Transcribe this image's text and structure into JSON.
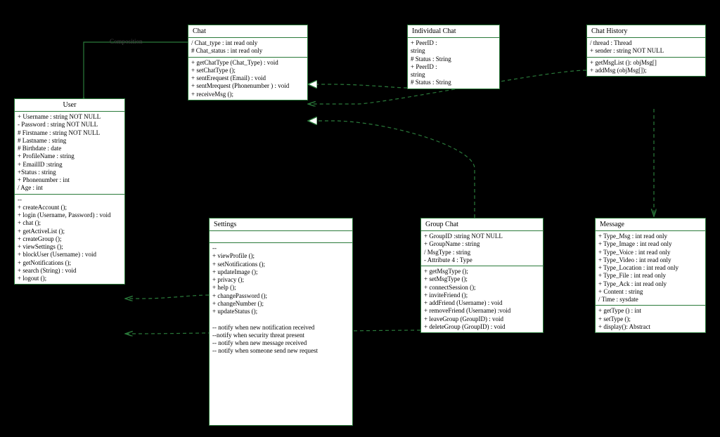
{
  "diagram_type": "UML Class Diagram",
  "classes": {
    "user": {
      "name": "User",
      "attrs": [
        "+ Username   : string  NOT NULL",
        "- Password   : string  NOT NULL",
        "# Firstname    : string  NOT NULL",
        "# Lastname         : string",
        "# Birthdate          : date",
        "+ ProfileName   : string",
        "+ EmailID       :string",
        "+Status            : string",
        "+ Phonenumber    : int",
        "/  Age               : int"
      ],
      "ops": [
        "--",
        "+ createAccount  ();",
        "+ login (Username, Password)  : void",
        "+ chat ();",
        "+ getActiveList  ();",
        "+ createGroup  ();",
        "+ viewSettings  ();",
        "+ blockUser  (Username)  : void",
        "+ getNotifications  ();",
        "+ search  (String) : void",
        "+ logout ();"
      ]
    },
    "chat": {
      "name": "Chat",
      "attrs": [
        "/ Chat_type   : int read only",
        "# Chat_status  : int read only"
      ],
      "ops": [
        "+ getChatType   (Chat_Type) : void",
        "+ setChatType   ();",
        "+ sentErequest   (Email)  : void",
        "+ sentMrequest   (Phonenumber  ) : void",
        "+ receiveMsg  ();"
      ]
    },
    "individual": {
      "name": "Individual Chat",
      "attrs": [
        "+ PeerID  :",
        "string",
        "# Status  : String",
        "+ PeerID   :",
        "string",
        "# Status  : String"
      ],
      "ops": []
    },
    "history": {
      "name": "Chat History",
      "attrs": [
        "/ thread  : Thread",
        "+ sender  : string  NOT NULL"
      ],
      "ops": [
        "+ getMsgList  (): objMsg[]",
        "+ addMsg  (objMsg[]);"
      ]
    },
    "settings": {
      "name": "Settings",
      "ops": [
        "--",
        "+ viewProfile ();",
        "+ setNotifications  ();",
        "+ updateImage   ();",
        "+ privacy ();",
        "+ help ();",
        "+ changePassword   ();",
        "+ changeNumber   ();",
        "+ updateStatus   ();",
        "",
        "-- notify when new notification  received",
        "--notify when security threat  present",
        "-- notify when new message  received",
        "-- notify when someone  send new request"
      ]
    },
    "group": {
      "name": "Group Chat",
      "attrs": [
        "+ GroupID :string NOT NULL",
        "+ GroupName  : string",
        "/ MsgType  : string",
        "- Attribute  4 : Type"
      ],
      "ops": [
        "+ getMsgType   ();",
        "+ setMsgType   ();",
        "+ connectSession   ();",
        "+ inviteFriend  ();",
        "+ addFriend  (Username)  : void",
        "+ removeFriend  (Username)  :void",
        "+ leaveGroup  (GroupID)  : void",
        "+ deleteGroup   (GroupID)  : void"
      ]
    },
    "message": {
      "name": "Message",
      "attrs": [
        "+ Type_Msg      : int read only",
        "+ Type_Image    : int read only",
        "+ Type_Voice    : int read only",
        "+ Type_Video  : int read only",
        "+ Type_Location  : int read only",
        "+ Type_File        : int read only",
        "+ Type_Ack        : int read only",
        "+ Content          : string",
        "/ Time              : sysdate"
      ],
      "ops": [
        "+ getType   () : int",
        "+ setType  ();",
        "+ display():  Abstract"
      ]
    }
  },
  "relations": [
    {
      "from": "user",
      "to": "chat",
      "style": "composition"
    },
    {
      "from": "individual",
      "to": "chat",
      "style": "realization"
    },
    {
      "from": "history",
      "to": "chat",
      "style": "dependency"
    },
    {
      "from": "group",
      "to": "chat",
      "style": "realization"
    },
    {
      "from": "settings",
      "to": "user",
      "style": "dependency"
    },
    {
      "from": "group",
      "to": "user",
      "style": "dependency"
    },
    {
      "from": "history",
      "to": "message",
      "style": "dependency"
    }
  ],
  "labels": {
    "composition": "Composition"
  }
}
